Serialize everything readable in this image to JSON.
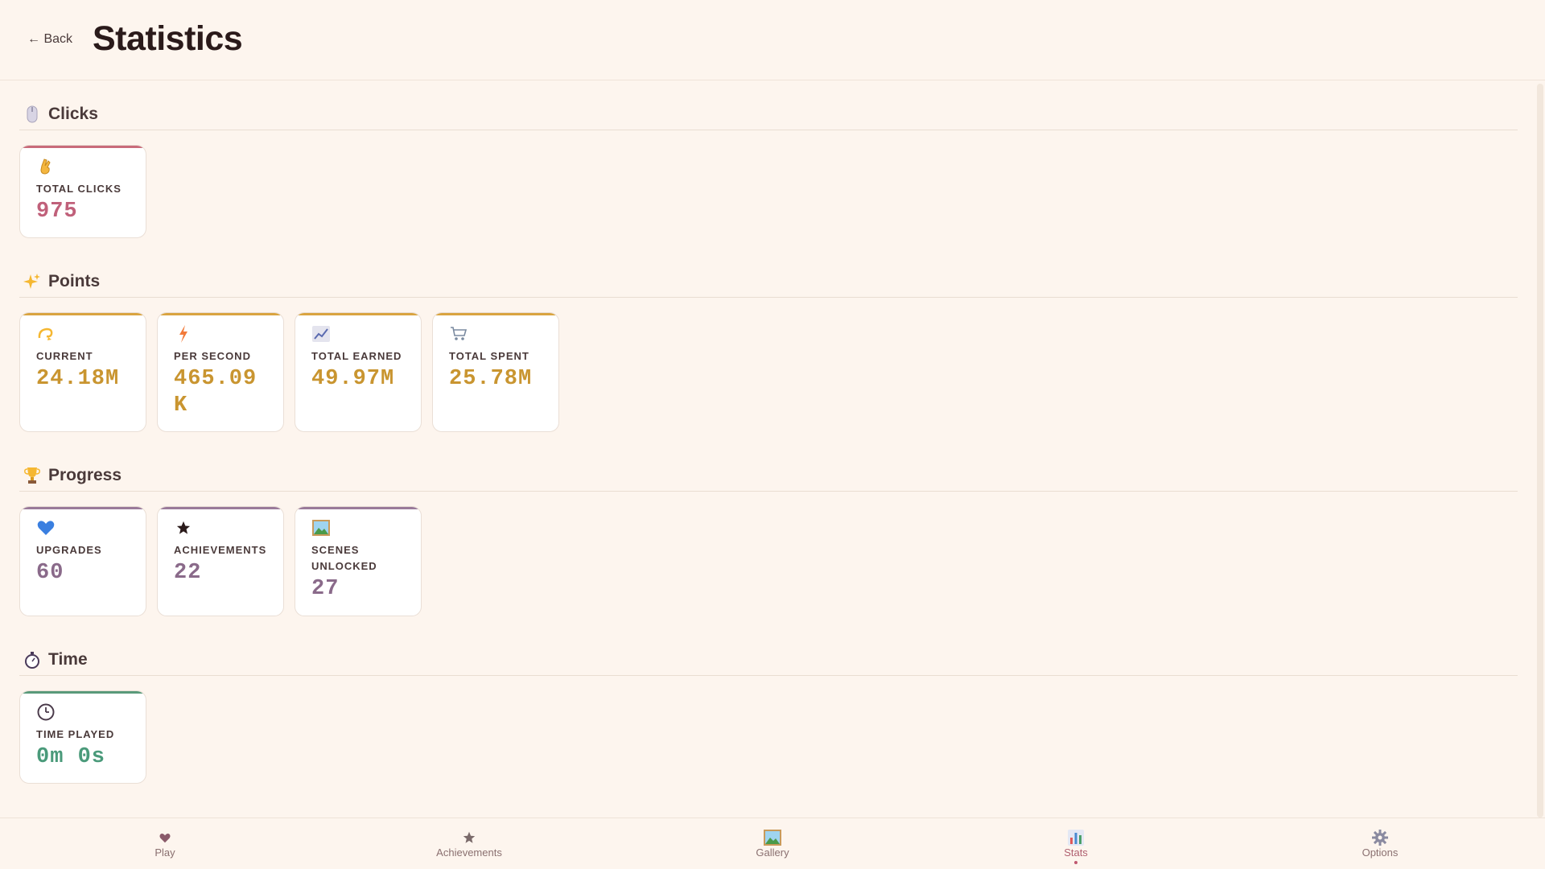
{
  "header": {
    "back_label": "← Back",
    "title": "Statistics"
  },
  "sections": [
    {
      "title": "Clicks",
      "icon": "computer-mouse-icon",
      "accent": "#c96b7a",
      "value_color": "#c0607a",
      "cards": [
        {
          "icon": "crossed-fingers-icon",
          "label": "TOTAL CLICKS",
          "value": "975"
        }
      ]
    },
    {
      "title": "Points",
      "icon": "sparkles-icon",
      "accent": "#d9a440",
      "value_color": "#c99530",
      "cards": [
        {
          "icon": "dizzy-icon",
          "label": "CURRENT",
          "value": "24.18M"
        },
        {
          "icon": "lightning-icon",
          "label": "PER SECOND",
          "value": "465.09K"
        },
        {
          "icon": "chart-increasing-icon",
          "label": "TOTAL EARNED",
          "value": "49.97M"
        },
        {
          "icon": "shopping-cart-icon",
          "label": "TOTAL SPENT",
          "value": "25.78M"
        }
      ]
    },
    {
      "title": "Progress",
      "icon": "trophy-icon",
      "accent": "#9a7a9a",
      "value_color": "#8a6a8a",
      "cards": [
        {
          "icon": "blue-heart-icon",
          "label": "UPGRADES",
          "value": "60"
        },
        {
          "icon": "star-icon",
          "label": "ACHIEVEMENTS",
          "value": "22"
        },
        {
          "icon": "framed-picture-icon",
          "label": "SCENES UNLOCKED",
          "value": "27"
        }
      ]
    },
    {
      "title": "Time",
      "icon": "stopwatch-icon",
      "accent": "#5a9a7a",
      "value_color": "#4a9a7a",
      "cards": [
        {
          "icon": "clock-icon",
          "label": "TIME PLAYED",
          "value": "0m 0s"
        }
      ]
    }
  ],
  "nav": {
    "items": [
      {
        "label": "Play",
        "icon": "heart-icon",
        "active": false
      },
      {
        "label": "Achievements",
        "icon": "star-icon",
        "active": false
      },
      {
        "label": "Gallery",
        "icon": "framed-picture-icon",
        "active": false
      },
      {
        "label": "Stats",
        "icon": "bar-chart-icon",
        "active": true
      },
      {
        "label": "Options",
        "icon": "gear-icon",
        "active": false
      }
    ]
  }
}
